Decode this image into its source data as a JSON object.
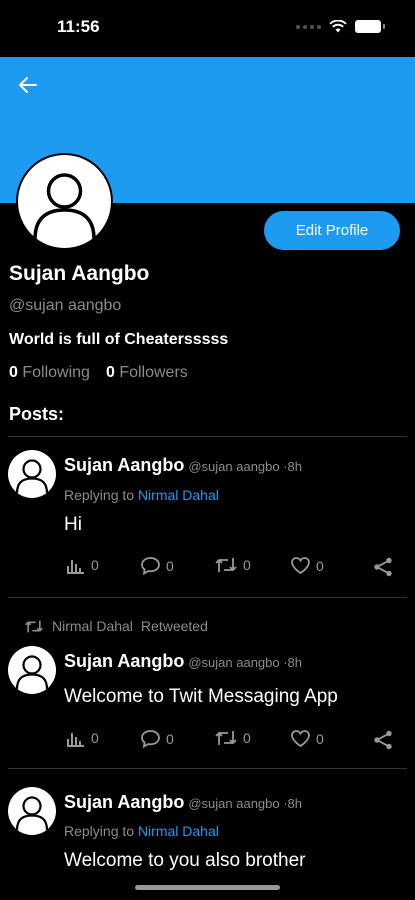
{
  "status_bar": {
    "time": "11:56"
  },
  "profile": {
    "name": "Sujan Aangbo",
    "handle": "@sujan aangbo",
    "bio": "World is full of Cheatersssss",
    "following_count": "0",
    "following_label": "Following",
    "followers_count": "0",
    "followers_label": "Followers",
    "edit_button": "Edit Profile",
    "banner_color": "#1d9bf0"
  },
  "posts_label": "Posts:",
  "posts": [
    {
      "name": "Sujan Aangbo",
      "meta": "@sujan aangbo ·8h",
      "replying_prefix": "Replying to",
      "replying_to": "Nirmal Dahal",
      "text": "Hi",
      "views": "0",
      "comments": "0",
      "retweets": "0",
      "likes": "0"
    },
    {
      "retweeted_by": "Nirmal Dahal",
      "retweeted_label": "Retweeted",
      "name": "Sujan Aangbo",
      "meta": "@sujan aangbo ·8h",
      "text": "Welcome to Twit Messaging App",
      "views": "0",
      "comments": "0",
      "retweets": "0",
      "likes": "0"
    },
    {
      "name": "Sujan Aangbo",
      "meta": "@sujan aangbo ·8h",
      "replying_prefix": "Replying to",
      "replying_to": "Nirmal Dahal",
      "text": "Welcome to you also brother"
    }
  ],
  "icons": {
    "back": "arrow-left-icon",
    "views": "bar-chart-icon",
    "comment": "comment-icon",
    "retweet": "retweet-icon",
    "like": "heart-icon",
    "share": "share-icon",
    "avatar": "user-icon"
  },
  "colors": {
    "accent": "#1d9bf0",
    "background": "#000000",
    "muted": "#8b8b8b"
  }
}
